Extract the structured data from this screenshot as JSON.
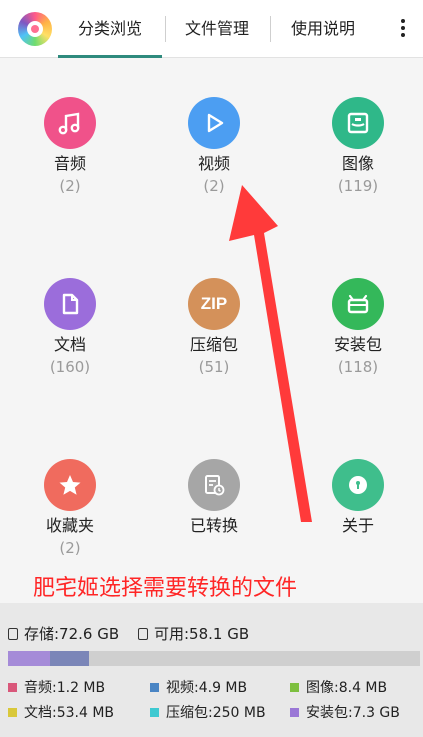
{
  "tabs": [
    {
      "label": "分类浏览",
      "active": true
    },
    {
      "label": "文件管理",
      "active": false
    },
    {
      "label": "使用说明",
      "active": false
    }
  ],
  "categories": [
    {
      "label": "音频",
      "count": "(2)",
      "color": "#f0528a",
      "icon": "music-note-icon"
    },
    {
      "label": "视频",
      "count": "(2)",
      "color": "#4c9ef2",
      "icon": "play-icon"
    },
    {
      "label": "图像",
      "count": "(119)",
      "color": "#2fb889",
      "icon": "image-icon"
    },
    {
      "label": "文档",
      "count": "(160)",
      "color": "#9b6ddb",
      "icon": "document-icon"
    },
    {
      "label": "压缩包",
      "count": "(51)",
      "color": "#d4915a",
      "icon": "zip-icon",
      "icon_text": "ZIP"
    },
    {
      "label": "安装包",
      "count": "(118)",
      "color": "#34b85a",
      "icon": "android-icon"
    },
    {
      "label": "收藏夹",
      "count": "(2)",
      "color": "#f06b5e",
      "icon": "star-icon"
    },
    {
      "label": "已转换",
      "count": "",
      "color": "#a6a6a6",
      "icon": "converted-icon"
    },
    {
      "label": "关于",
      "count": "",
      "color": "#3fbe8c",
      "icon": "info-icon"
    }
  ],
  "annotation": "肥宅姬选择需要转换的文件",
  "storage": {
    "total": "存储:72.6 GB",
    "free": "可用:58.1 GB",
    "bar_colors": {
      "track": "#cfcfcf",
      "purple": "#a58bd8",
      "slate": "#7b86b8"
    },
    "legend": [
      {
        "label": "音频:1.2 MB",
        "color": "#d9577a"
      },
      {
        "label": "视频:4.9 MB",
        "color": "#4a85c4"
      },
      {
        "label": "图像:8.4 MB",
        "color": "#7dbf3f"
      },
      {
        "label": "文档:53.4 MB",
        "color": "#d9c83a"
      },
      {
        "label": "压缩包:250 MB",
        "color": "#3ec9d1"
      },
      {
        "label": "安装包:7.3 GB",
        "color": "#9a77d6"
      }
    ]
  }
}
